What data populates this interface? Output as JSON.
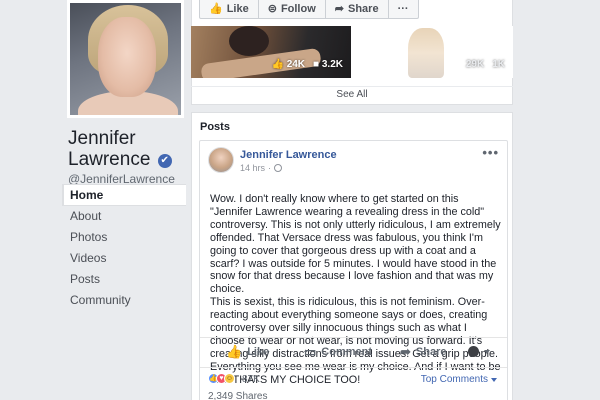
{
  "profile": {
    "name_line1": "Jennifer",
    "name_line2": "Lawrence",
    "verified_icon": "✔",
    "handle": "@JenniferLawrence"
  },
  "sidebar": {
    "items": [
      {
        "label": "Home",
        "active": true
      },
      {
        "label": "About"
      },
      {
        "label": "Photos"
      },
      {
        "label": "Videos"
      },
      {
        "label": "Posts"
      },
      {
        "label": "Community"
      }
    ]
  },
  "toolbar": {
    "like_label": "Like",
    "follow_label": "Follow",
    "share_label": "Share",
    "more_label": "···"
  },
  "photos": {
    "p1_likes": "24K",
    "p1_comments": "3.2K",
    "p2_likes": "29K",
    "p2_comments": "1K",
    "see_all": "See All"
  },
  "posts": {
    "title": "Posts",
    "post": {
      "author": "Jennifer Lawrence",
      "time": "14 hrs",
      "menu": "•••",
      "text": "Wow. I don't really know where to get started on this \"Jennifer Lawrence wearing a revealing dress in the cold\" controversy. This is not only utterly ridiculous, I am extremely offended. That Versace dress was fabulous, you think I'm going to cover that gorgeous dress up with a coat and a scarf? I was outside for 5 minutes. I would have stood in the snow for that dress because I love fashion and that was my choice.\nThis is sexist, this is ridiculous, this is not feminism. Over- reacting about everything someone says or does, creating controversy over silly innocuous things such as what I choose to wear or not wear, is not moving us forward. It's creating silly distractions from real issues. Get a grip people. Everything you see me wear is my choice. And if I want to be cold THATS MY CHOICE TOO!",
      "like_label": "Like",
      "comment_label": "Comment",
      "share_label": "Share",
      "reaction_count": "87K",
      "top_comments_label": "Top Comments",
      "shares_label": "2,349 Shares"
    }
  },
  "colors": {
    "brand": "#4267b2",
    "link": "#365899",
    "background": "#e9ebee"
  }
}
